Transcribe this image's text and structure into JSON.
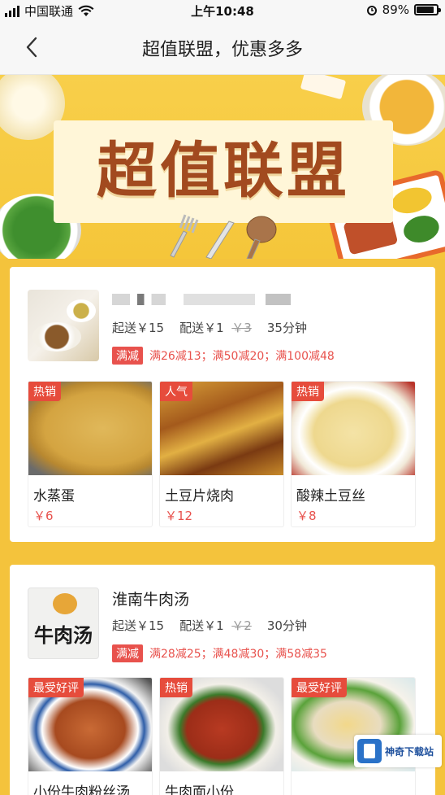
{
  "status_bar": {
    "carrier": "中国联通",
    "time": "上午10:48",
    "battery": "89%",
    "battery_level": 0.89
  },
  "nav": {
    "title": "超值联盟，优惠多多"
  },
  "banner": {
    "title": "超值联盟"
  },
  "stores": [
    {
      "name": "",
      "min_order_label": "起送￥15",
      "delivery_label": "配送￥1",
      "delivery_original": "￥3",
      "delivery_time": "35分钟",
      "promo_tag": "满减",
      "promo_text": "满26减13；满50减20；满100减48",
      "dishes": [
        {
          "badge": "热销",
          "name": "水蒸蛋",
          "price": "￥6"
        },
        {
          "badge": "人气",
          "name": "土豆片烧肉",
          "price": "￥12"
        },
        {
          "badge": "热销",
          "name": "酸辣土豆丝",
          "price": "￥8"
        }
      ]
    },
    {
      "name": "淮南牛肉汤",
      "thumb_text": "牛肉汤",
      "min_order_label": "起送￥15",
      "delivery_label": "配送￥1",
      "delivery_original": "￥2",
      "delivery_time": "30分钟",
      "promo_tag": "满减",
      "promo_text": "满28减25；满48减30；满58减35",
      "dishes": [
        {
          "badge": "最受好评",
          "name": "小份牛肉粉丝汤",
          "price": ""
        },
        {
          "badge": "热销",
          "name": "牛肉面小份",
          "price": ""
        },
        {
          "badge": "最受好评",
          "name": "",
          "price": ""
        }
      ]
    }
  ],
  "watermark": {
    "text": "神奇下载站"
  },
  "colors": {
    "banner_yellow": "#f5c63a",
    "title_brown": "#a24a1f",
    "promo_red": "#e8524d",
    "badge_red": "#e64c3c"
  }
}
